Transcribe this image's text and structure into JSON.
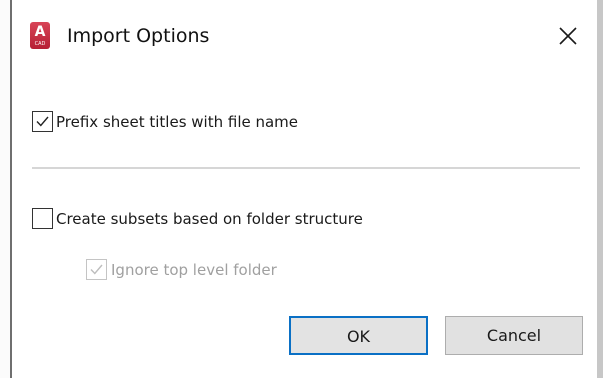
{
  "window": {
    "title": "Import Options",
    "app_icon": {
      "name": "autocad-app-icon",
      "letter": "A",
      "caption": "CAD",
      "color": "#c8283d"
    },
    "close_icon": "close-icon"
  },
  "options": {
    "prefix_titles": {
      "label": "Prefix sheet titles with file name",
      "checked": true,
      "enabled": true
    },
    "create_subsets": {
      "label": "Create subsets based on folder structure",
      "checked": false,
      "enabled": true
    },
    "ignore_top_folder": {
      "label": "Ignore top level folder",
      "checked": true,
      "enabled": false
    }
  },
  "buttons": {
    "ok_label": "OK",
    "cancel_label": "Cancel"
  },
  "colors": {
    "default_button_border": "#0a70c5",
    "disabled_text": "#a0a0a0",
    "checkbox_border": "#333333"
  }
}
